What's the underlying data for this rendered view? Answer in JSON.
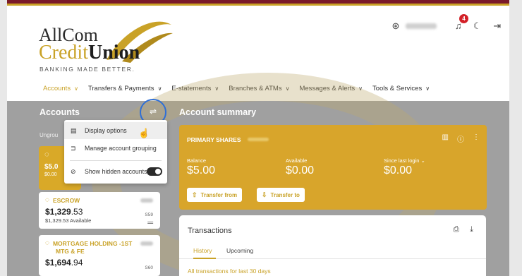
{
  "logo": {
    "line1": "AllCom",
    "credit": "Credit",
    "union": "Union",
    "tagline": "BANKING MADE BETTER."
  },
  "header": {
    "notification_count": "4"
  },
  "nav": [
    {
      "label": "Accounts"
    },
    {
      "label": "Transfers & Payments"
    },
    {
      "label": "E-statements"
    },
    {
      "label": "Branches & ATMs"
    },
    {
      "label": "Messages & Alerts"
    },
    {
      "label": "Tools & Services"
    }
  ],
  "accounts_panel": {
    "title": "Accounts",
    "ungrouped_label": "Ungrou",
    "gold_card": {
      "amount": "$5.0",
      "sub": "$0.00"
    },
    "cards": [
      {
        "name": "ESCROW",
        "amount_main": "$1,329",
        "amount_cents": ".53",
        "available": "$1,329.53 Available",
        "number": "S59"
      },
      {
        "name": "MORTGAGE HOLDING -1ST",
        "name2": "MTG & FE",
        "amount_main": "$1,694",
        "amount_cents": ".94",
        "number": "S60"
      }
    ]
  },
  "dropdown": {
    "items": [
      {
        "label": "Display options"
      },
      {
        "label": "Manage account grouping"
      },
      {
        "label": "Show hidden accounts"
      }
    ]
  },
  "summary": {
    "title": "Account summary",
    "account_name": "PRIMARY SHARES",
    "balance_label": "Balance",
    "balance_value": "$5.00",
    "available_label": "Available",
    "available_value": "$0.00",
    "since_label": "Since last login",
    "since_value": "$0.00",
    "transfer_from": "Transfer from",
    "transfer_to": "Transfer to"
  },
  "transactions": {
    "title": "Transactions",
    "tabs": [
      "History",
      "Upcoming"
    ],
    "filter_prefix": "All transactions for",
    "filter_period": "last 30 days"
  },
  "colors": {
    "gold": "#d8a52b",
    "accent": "#c9a227",
    "maroon": "#7a1a2a",
    "highlight": "#2f6fd6"
  }
}
